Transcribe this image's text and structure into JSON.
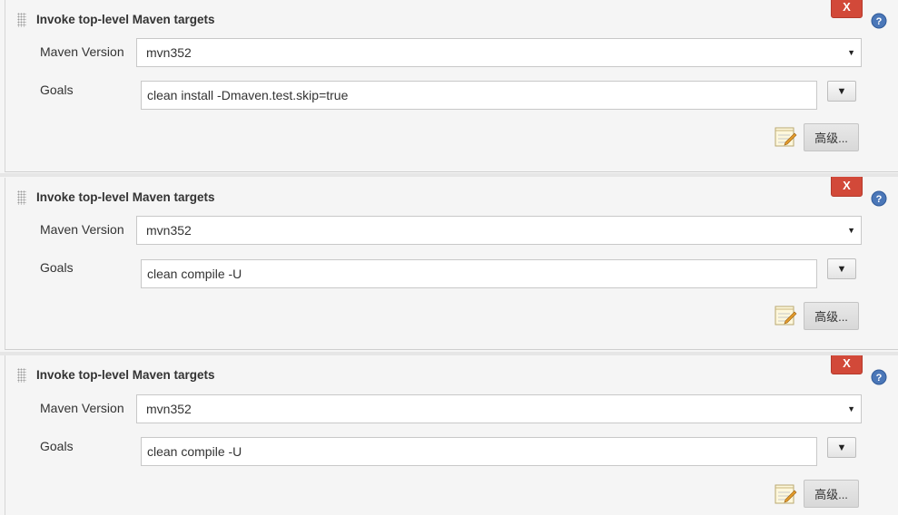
{
  "steps": [
    {
      "title": "Invoke top-level Maven targets",
      "delete_label": "X",
      "maven_version_label": "Maven Version",
      "maven_version_value": "mvn352",
      "goals_label": "Goals",
      "goals_value": "clean install  -Dmaven.test.skip=true",
      "advanced_label": "高级..."
    },
    {
      "title": "Invoke top-level Maven targets",
      "delete_label": "X",
      "maven_version_label": "Maven Version",
      "maven_version_value": "mvn352",
      "goals_label": "Goals",
      "goals_value": "clean compile -U",
      "advanced_label": "高级..."
    },
    {
      "title": "Invoke top-level Maven targets",
      "delete_label": "X",
      "maven_version_label": "Maven Version",
      "maven_version_value": "mvn352",
      "goals_label": "Goals",
      "goals_value": "clean compile -U",
      "advanced_label": "高级..."
    }
  ],
  "icons": {
    "drag": "drag-handle-icon",
    "help": "help-icon",
    "dropdown": "dropdown-caret-icon",
    "expand": "expand-textarea-icon",
    "notepad": "notepad-icon"
  },
  "colors": {
    "delete_button": "#d24939",
    "help_icon": "#4b77b8",
    "panel_background": "#f5f5f5"
  }
}
